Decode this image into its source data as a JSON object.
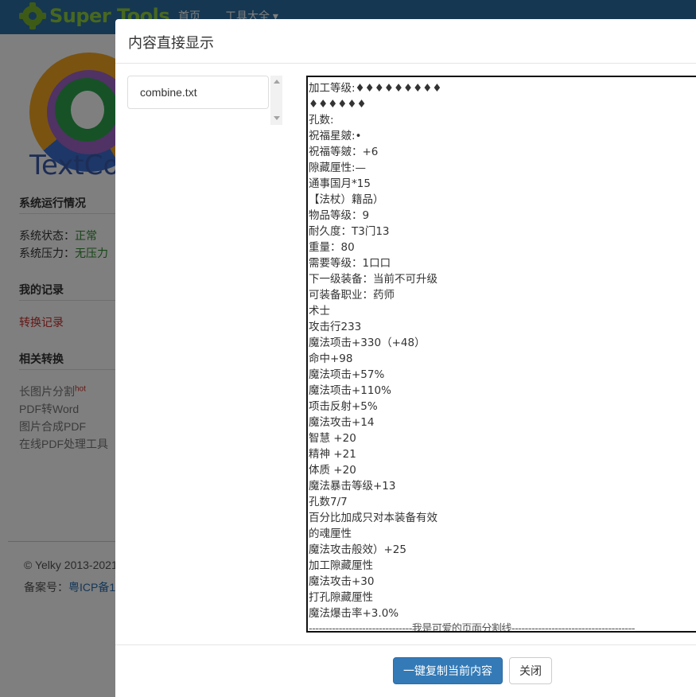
{
  "navbar": {
    "logo_text": "Super Tools",
    "home": "首页",
    "tools": "工具大全 ▾"
  },
  "background": {
    "logo_text": "TextCo",
    "sections": {
      "system_title": "系统运行情况",
      "status_label": "系统状态：",
      "status_value": "正常",
      "pressure_label": "系统压力：",
      "pressure_value": "无压力",
      "records_title": "我的记录",
      "records_link": "转换记录",
      "related_title": "相关转换",
      "related_links": [
        "长图片分割",
        "PDF转Word",
        "图片合成PDF",
        "在线PDF处理工具"
      ],
      "hot_badge": "hot"
    },
    "footer": {
      "copyright": "© Yelky 2013-2021",
      "icp_label": "备案号：",
      "icp_link": "粤ICP备1"
    }
  },
  "modal": {
    "title": "内容直接显示",
    "file_name": "combine.txt",
    "content_lines": [
      "加工等级:♦♦♦♦♦♦♦♦♦",
      "♦♦♦♦♦♦",
      "孔数:",
      "祝福星皴:•",
      "祝福等皴：+6",
      "隙藏厘性:—",
      "通事国月*15",
      "【法杖）籍品）",
      "物品等级：9",
      "耐久度：T3门13",
      "重量：80",
      "需要等级：1口口",
      "下一级装备：当前不可升级",
      "可装备职业：药师",
      "术士",
      "攻击行233",
      "魔法项击+330（+48）",
      "命中+98",
      "魔法项击+57%",
      "魔法项击+110%",
      "项击反射+5%",
      "魔法攻击+14",
      "智慧 +20",
      "精神 +21",
      "体质 +20",
      "魔法暴击等级+13",
      "孔数7/7",
      "百分比加成只对本装备有效",
      "的魂厘性",
      "魔法攻击般效）+25",
      "加工隙藏厘性",
      "魔法攻击+30",
      "打孔隙藏厘性",
      "魔法爆击率+3.0%"
    ],
    "divider": "-------------------------------我是可爱的页面分割线-------------------------------------",
    "copy_button": "一键复制当前内容",
    "close_button": "关闭"
  }
}
